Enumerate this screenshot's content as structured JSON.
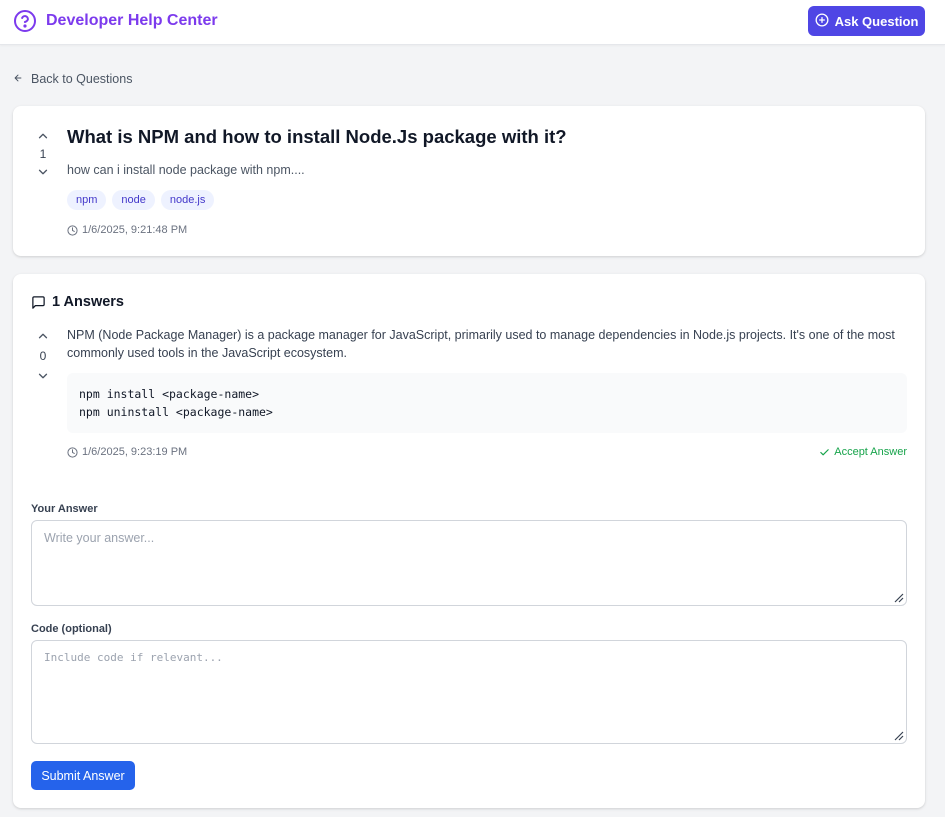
{
  "header": {
    "brand_title": "Developer Help Center",
    "brand_icon": "help-circle-icon",
    "ask_label": "Ask Question",
    "ask_icon": "plus-circle-icon",
    "accent": "#7c3aed",
    "button_color": "#4f46e5"
  },
  "nav": {
    "back_label": "Back to Questions"
  },
  "question": {
    "title": "What is NPM and how to install Node.Js package with it?",
    "body": "how can i install node package with npm....",
    "votes": "1",
    "tags": [
      "npm",
      "node",
      "node.js"
    ],
    "timestamp": "1/6/2025, 9:21:48 PM"
  },
  "answers": {
    "heading": "1 Answers",
    "items": [
      {
        "votes": "0",
        "text": "NPM (Node Package Manager) is a package manager for JavaScript, primarily used to manage dependencies in Node.js projects. It's one of the most commonly used tools in the JavaScript ecosystem.",
        "code_line_1": "npm install <package-name>",
        "code_line_2": "npm uninstall <package-name>",
        "timestamp": "1/6/2025, 9:23:19 PM",
        "accept_label": "Accept Answer"
      }
    ]
  },
  "form": {
    "answer_label": "Your Answer",
    "answer_placeholder": "Write your answer...",
    "code_label": "Code (optional)",
    "code_placeholder": "Include code if relevant...",
    "submit_label": "Submit Answer",
    "submit_color": "#2563eb"
  }
}
